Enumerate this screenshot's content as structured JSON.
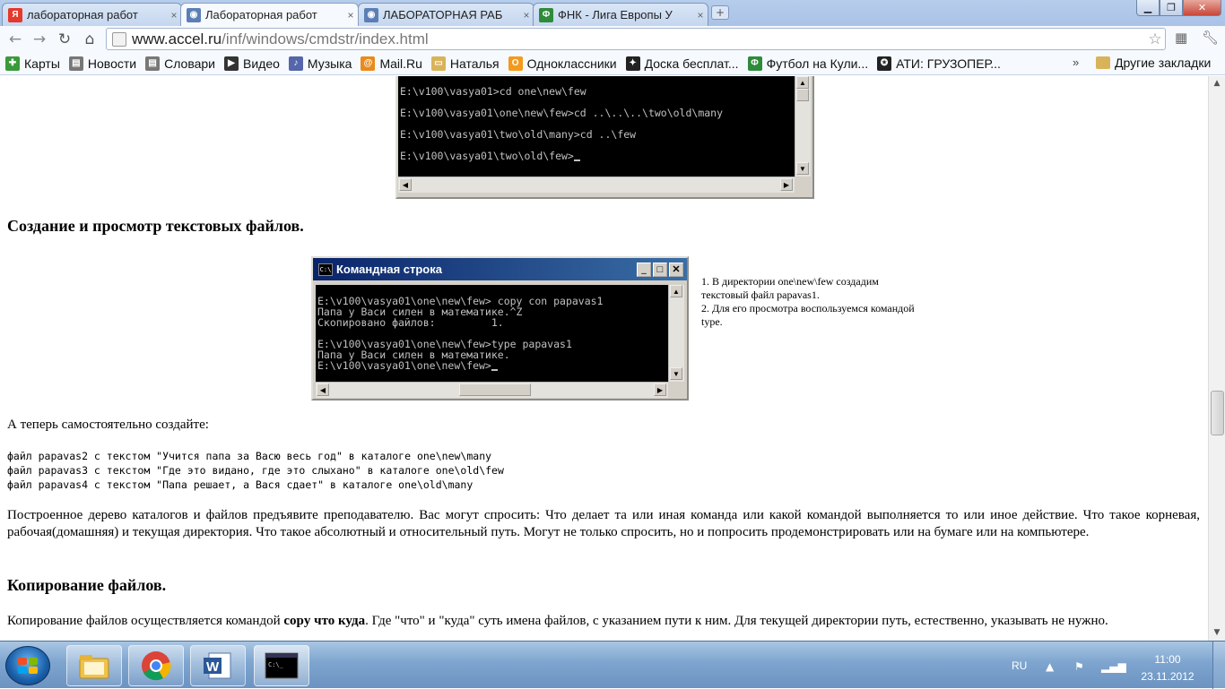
{
  "browser": {
    "tabs": [
      {
        "title": "лабораторная работ",
        "favicon": "yandex-favicon",
        "color": "#e4392b",
        "glyph": "Я"
      },
      {
        "title": "Лабораторная работ",
        "favicon": "page-favicon",
        "color": "#5b7fb5",
        "glyph": "◉"
      },
      {
        "title": "ЛАБОРАТОРНАЯ РАБ",
        "favicon": "page-favicon",
        "color": "#5b7fb5",
        "glyph": "◉"
      },
      {
        "title": "ФНК - Лига Европы У",
        "favicon": "fnk-favicon",
        "color": "#2e8b3a",
        "glyph": "Ф"
      }
    ],
    "active_tab_index": 1,
    "url_host": "www.accel.ru",
    "url_path": "/inf/windows/cmdstr/index.html",
    "bookmarks": [
      {
        "label": "Карты",
        "color": "#3a9a3a",
        "glyph": "✚"
      },
      {
        "label": "Новости",
        "color": "#777777",
        "glyph": "▤"
      },
      {
        "label": "Словари",
        "color": "#777777",
        "glyph": "▤"
      },
      {
        "label": "Видео",
        "color": "#333333",
        "glyph": "▶"
      },
      {
        "label": "Музыка",
        "color": "#5566aa",
        "glyph": "♪"
      },
      {
        "label": "Mail.Ru",
        "color": "#e98a1a",
        "glyph": "@"
      },
      {
        "label": "Наталья",
        "color": "#d9b35a",
        "glyph": "▭"
      },
      {
        "label": "Одноклассники",
        "color": "#f39a1d",
        "glyph": "О"
      },
      {
        "label": "Доска бесплат...",
        "color": "#222222",
        "glyph": "✦"
      },
      {
        "label": "Футбол на Кули...",
        "color": "#2e8b3a",
        "glyph": "Ф"
      },
      {
        "label": "АТИ: ГРУЗОПЕР...",
        "color": "#222222",
        "glyph": "✪"
      }
    ],
    "more_label": "»",
    "other_bookmarks": "Другие закладки"
  },
  "page": {
    "console1_lines": [
      "E:\\v100\\vasya01>cd one\\new\\few",
      "E:\\v100\\vasya01\\one\\new\\few>cd ..\\..\\..\\two\\old\\many",
      "E:\\v100\\vasya01\\two\\old\\many>cd ..\\few",
      "E:\\v100\\vasya01\\two\\old\\few>"
    ],
    "heading_create": "Создание и просмотр текстовых файлов.",
    "console2_title": "Командная строка",
    "console2_lines": [
      "E:\\v100\\vasya01\\one\\new\\few> copy con papavas1",
      "Папа у Васи силен в математике.^Z",
      "Скопировано файлов:         1.",
      "",
      "E:\\v100\\vasya01\\one\\new\\few>type papavas1",
      "Папа у Васи силен в математике.",
      "E:\\v100\\vasya01\\one\\new\\few>"
    ],
    "side_note_1": "1. В директории one\\new\\few создадим текстовый файл papavas1.",
    "side_note_2": "2. Для его просмотра воспользуемся командой type.",
    "task_intro": "А теперь самостоятельно создайте:",
    "task_lines": [
      "файл papavas2 с текстом \"Учится папа за Васю весь год\" в каталоге one\\new\\many",
      "файл papavas3 с текстом \"Где это видано, где это слыхано\" в каталоге one\\old\\few",
      "файл papavas4 с текстом \"Папа решает, а Вася сдает\" в каталоге one\\old\\many"
    ],
    "paragraph_tree": "Построенное дерево каталогов и файлов предъявите преподавателю. Вас могут спросить: Что делает та или иная команда или какой командой выполняется то или иное действие. Что такое корневая, рабочая(домашняя) и текущая директория. Что такое абсолютный и относительный путь. Могут не только спросить, но и попросить продемонстрировать или на бумаге или на компьютере.",
    "heading_copy": "Копирование файлов.",
    "copy_pre": "Копирование файлов осуществляется командой ",
    "copy_bold": "copy что куда",
    "copy_post": ". Где \"что\" и \"куда\" суть имена файлов, с указанием пути к ним. Для текущей директории путь, естественно, указывать не нужно."
  },
  "taskbar": {
    "lang": "RU",
    "time": "11:00",
    "date": "23.11.2012",
    "pinned": [
      "explorer-icon",
      "chrome-icon",
      "word-icon",
      "cmd-icon"
    ]
  }
}
